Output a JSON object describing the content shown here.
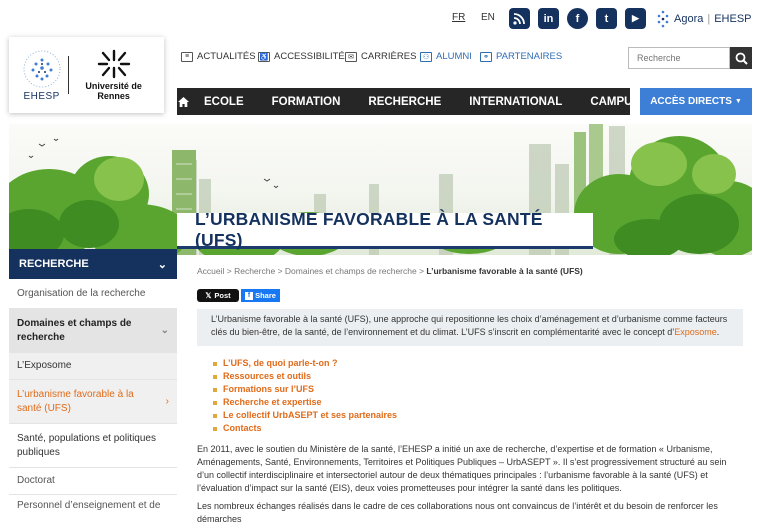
{
  "lang": {
    "fr": "FR",
    "en": "EN"
  },
  "social": {
    "rss": "rss-icon",
    "linkedin": "in",
    "facebook": "f",
    "twitter": "t",
    "youtube": "▶"
  },
  "agora": {
    "prefix": "Agora",
    "suffix": "EHESP"
  },
  "logos": {
    "ehesp": "EHESP",
    "rennes": "Université de Rennes"
  },
  "utility_nav": [
    {
      "label": "ACTUALITÉS",
      "icon": "newspaper-icon"
    },
    {
      "label": "ACCESSIBILITÉ",
      "icon": "accessibility-icon"
    },
    {
      "label": "CARRIÈRES",
      "icon": "envelope-icon"
    },
    {
      "label": "ALUMNI",
      "icon": "users-icon"
    },
    {
      "label": "PARTENAIRES",
      "icon": "handshake-icon"
    }
  ],
  "search": {
    "placeholder": "Recherche"
  },
  "main_nav": [
    "ECOLE",
    "FORMATION",
    "RECHERCHE",
    "INTERNATIONAL",
    "CAMPUS"
  ],
  "acces": "ACCÈS DIRECTS",
  "page_title": "L’URBANISME FAVORABLE À LA SANTÉ (UFS)",
  "sidebar": {
    "heading": "RECHERCHE",
    "items": [
      {
        "label": "Organisation de la recherche"
      },
      {
        "label": "Domaines et champs de recherche"
      },
      {
        "label": "L’Exposome"
      },
      {
        "label": "L’urbanisme favorable à la santé (UFS)"
      },
      {
        "label": "Santé, populations et politiques publiques"
      },
      {
        "label": "Doctorat"
      },
      {
        "label": "Personnel d’enseignement et de"
      }
    ]
  },
  "breadcrumb": {
    "items": [
      "Accueil",
      "Recherche",
      "Domaines et champs de recherche"
    ],
    "current": "L’urbanisme favorable à la santé (UFS)"
  },
  "share": {
    "tweet": "Post",
    "facebook": "Share"
  },
  "intro": {
    "text": "L’Urbanisme favorable à la santé (UFS), une approche qui repositionne les choix d’aménagement et d’urbanisme comme facteurs clés du bien-être, de la santé, de l’environnement et du climat. L’UFS s’inscrit en complémentarité avec le concept d’",
    "link": "Exposome",
    "end": "."
  },
  "links": [
    "L’UFS, de quoi parle-t-on ?",
    "Ressources et outils",
    "Formations sur l’UFS",
    "Recherche et expertise",
    "Le collectif UrbASEPT et ses partenaires",
    "Contacts"
  ],
  "paragraphs": [
    "En 2011, avec le soutien du Ministère de la santé, l’EHESP a initié un axe de recherche, d’expertise et de formation « Urbanisme, Aménagements, Santé, Environnements, Territoires et Politiques Publiques – UrbASEPT ». Il s’est progressivement structuré au sein d’un collectif interdisciplinaire et intersectoriel autour de deux thématiques principales : l’urbanisme favorable à la santé (UFS) et l’évaluation d’impact sur la santé (EIS), deux voies prometteuses pour intégrer la santé dans les politiques.",
    "Les nombreux échanges réalisés dans le cadre de ces collaborations nous ont convaincus de l’intérêt et du besoin de renforcer les démarches"
  ],
  "colors": {
    "navy": "#15325f",
    "accent_blue": "#3d7fd6",
    "orange": "#e06b1a",
    "dark": "#262626"
  }
}
